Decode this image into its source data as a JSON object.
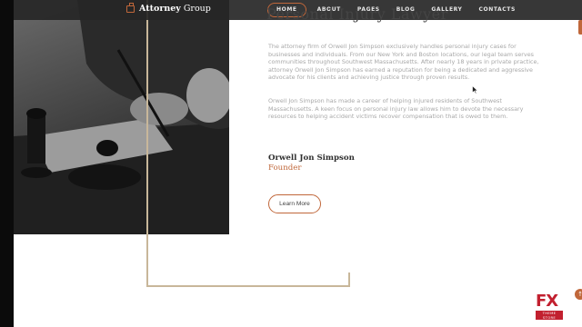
{
  "navbar": {
    "brand_bold": "Attorney",
    "brand_light": "Group",
    "items": [
      {
        "label": "HOME",
        "active": true
      },
      {
        "label": "ABOUT"
      },
      {
        "label": "PAGES"
      },
      {
        "label": "BLOG"
      },
      {
        "label": "GALLERY"
      },
      {
        "label": "CONTACTS"
      }
    ]
  },
  "content": {
    "heading": "Personal Injury Lawyer",
    "paragraph1": "The attorney firm of Orwell Jon Simpson exclusively handles personal injury cases for businesses and individuals. From our New York and Boston locations, our legal team serves communities throughout Southwest Massachusetts. After nearly 18 years in private practice, attorney Orwell Jon Simpson has earned a reputation for being a dedicated and aggressive advocate for his clients and achieving justice through proven results.",
    "paragraph2": "Orwell Jon Simpson has made a career of helping injured residents of Southwest Massachusetts. A keen focus on personal injury law allows him to devote the necessary resources to helping accident victims recover compensation that is owed to them.",
    "name": "Orwell Jon Simpson",
    "role": "Founder",
    "learn_more": "Learn More"
  },
  "watermark": {
    "fx": "FX",
    "sub": "THEME STORE"
  },
  "colors": {
    "accent": "#c0673a",
    "gold_line": "#c8b79a",
    "navbar_bg": "#262626"
  },
  "icons": {
    "brand": "briefcase-icon",
    "back_to_top": "arrow-up-icon",
    "cursor": "mouse-cursor-icon"
  }
}
